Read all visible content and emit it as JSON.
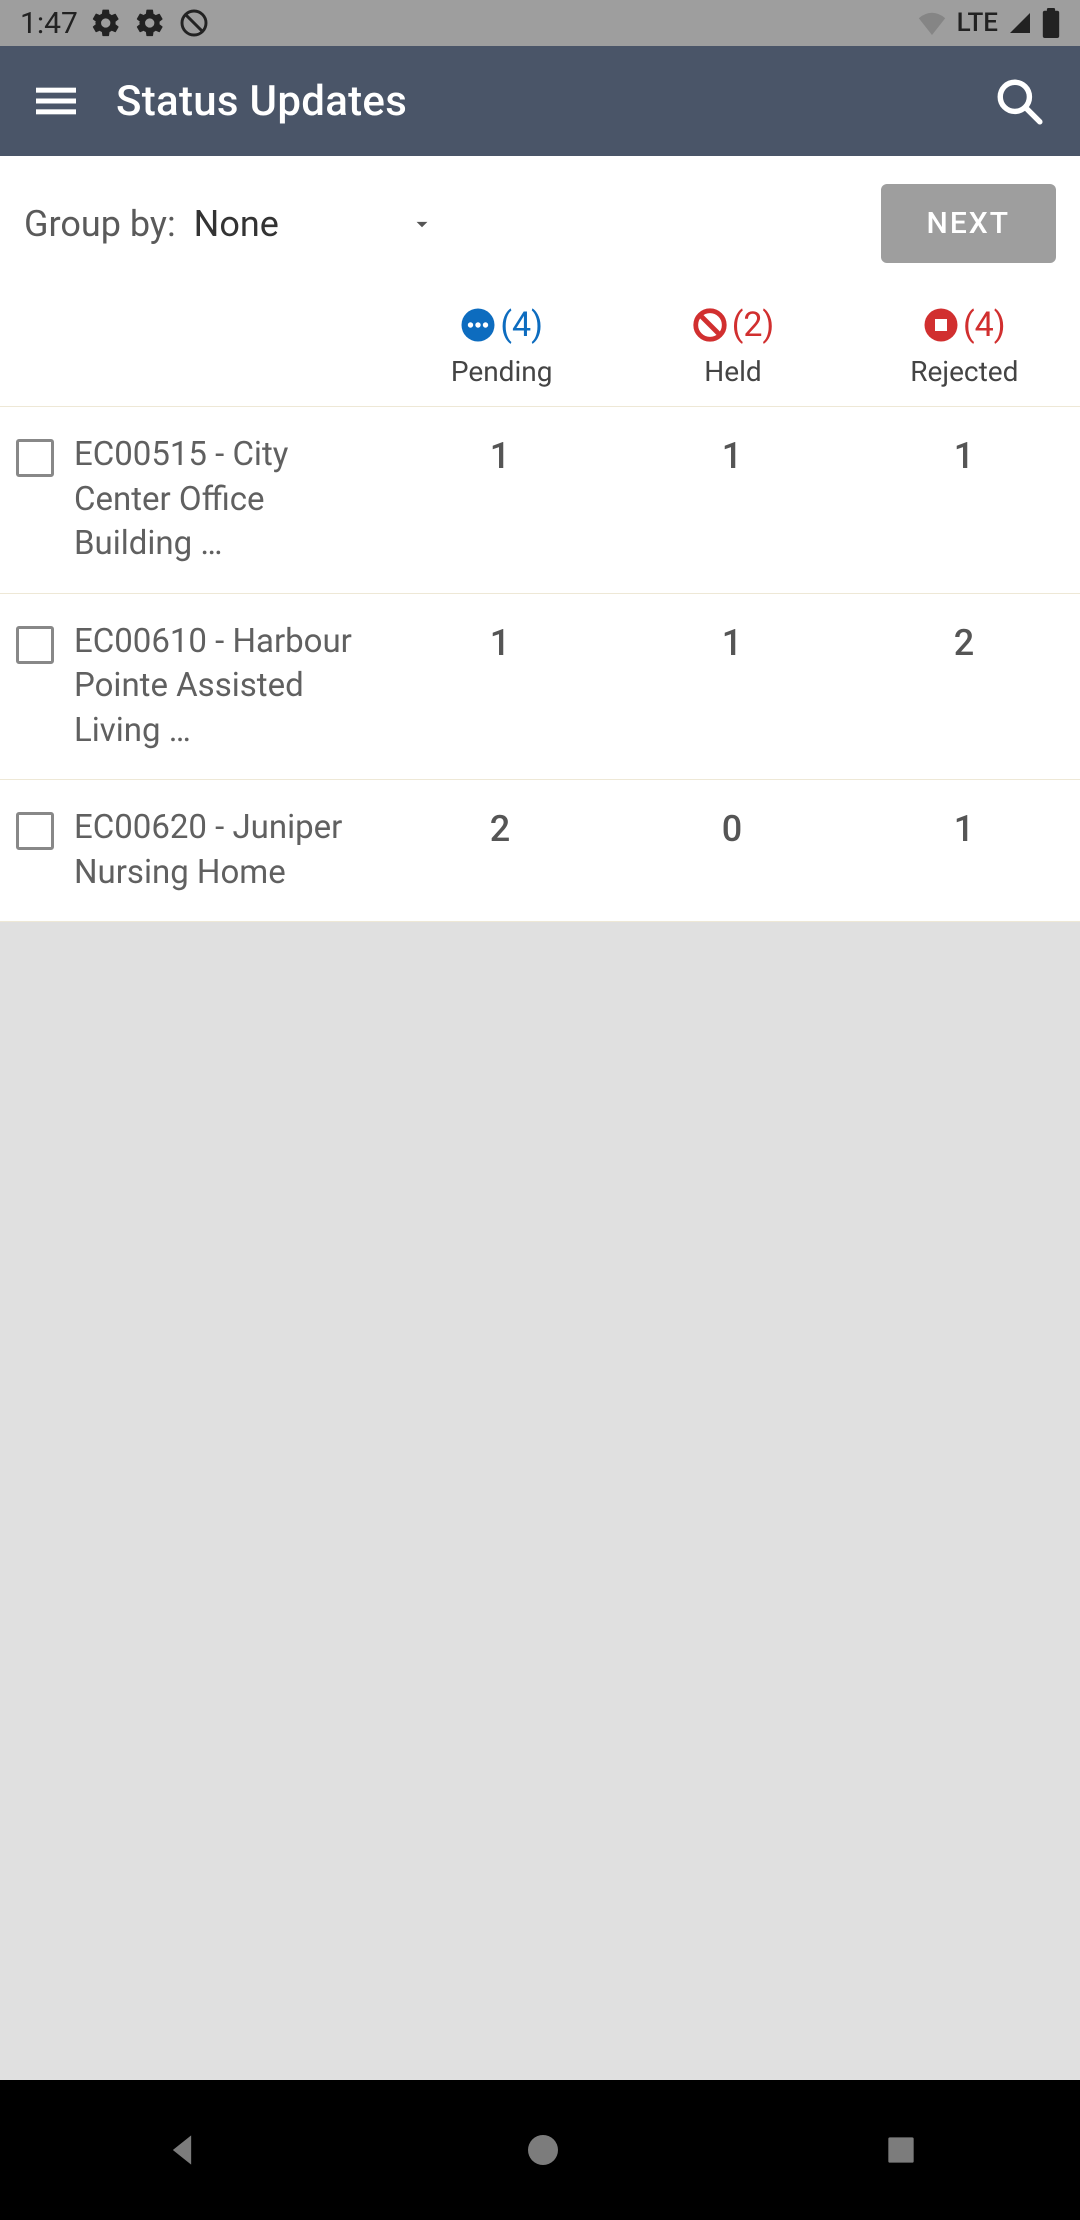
{
  "statusbar": {
    "time": "1:47",
    "network": "LTE"
  },
  "appbar": {
    "title": "Status Updates"
  },
  "filter": {
    "groupby_label": "Group by:",
    "groupby_value": "None",
    "next_label": "NEXT"
  },
  "columns": {
    "pending": {
      "label": "Pending",
      "count": "(4)"
    },
    "held": {
      "label": "Held",
      "count": "(2)"
    },
    "rejected": {
      "label": "Rejected",
      "count": "(4)"
    }
  },
  "rows": [
    {
      "name": "EC00515 - City Center Office Building …",
      "pending": "1",
      "held": "1",
      "rejected": "1"
    },
    {
      "name": "EC00610 - Harbour Pointe Assisted Living …",
      "pending": "1",
      "held": "1",
      "rejected": "2"
    },
    {
      "name": "EC00620 - Juniper Nursing Home",
      "pending": "2",
      "held": "0",
      "rejected": "1"
    }
  ]
}
